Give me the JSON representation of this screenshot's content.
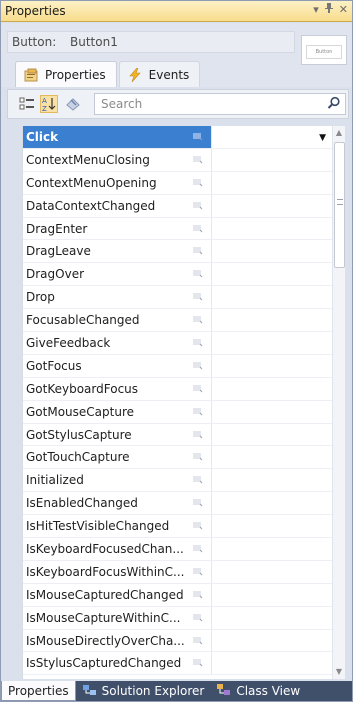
{
  "titlebar": {
    "title": "Properties",
    "icons": [
      "dropdown-arrow-icon",
      "pin-icon",
      "close-icon"
    ]
  },
  "object": {
    "type_label": "Button:",
    "name": "Button1",
    "preview_label": "Button"
  },
  "tabs": [
    {
      "label": "Properties",
      "icon": "properties-icon",
      "active": false
    },
    {
      "label": "Events",
      "icon": "lightning-icon",
      "active": true
    }
  ],
  "toolbar": {
    "search_placeholder": "Search",
    "buttons": [
      "categorized-icon",
      "alphabetical-icon",
      "clear-icon"
    ]
  },
  "events": [
    "Click",
    "ContextMenuClosing",
    "ContextMenuOpening",
    "DataContextChanged",
    "DragEnter",
    "DragLeave",
    "DragOver",
    "Drop",
    "FocusableChanged",
    "GiveFeedback",
    "GotFocus",
    "GotKeyboardFocus",
    "GotMouseCapture",
    "GotStylusCapture",
    "GotTouchCapture",
    "Initialized",
    "IsEnabledChanged",
    "IsHitTestVisibleChanged",
    "IsKeyboardFocusedChan...",
    "IsKeyboardFocusWithinC...",
    "IsMouseCapturedChanged",
    "IsMouseCaptureWithinC...",
    "IsMouseDirectlyOverCha...",
    "IsStylusCapturedChanged"
  ],
  "bottom_tabs": [
    {
      "label": "Properties",
      "icon": "",
      "active": true
    },
    {
      "label": "Solution Explorer",
      "icon": "solution-explorer-icon",
      "active": false
    },
    {
      "label": "Class View",
      "icon": "class-view-icon",
      "active": false
    }
  ],
  "colors": {
    "title_bg": "#f8dd8c",
    "selection": "#3b7fd1",
    "bottom_bar": "#40506b"
  }
}
